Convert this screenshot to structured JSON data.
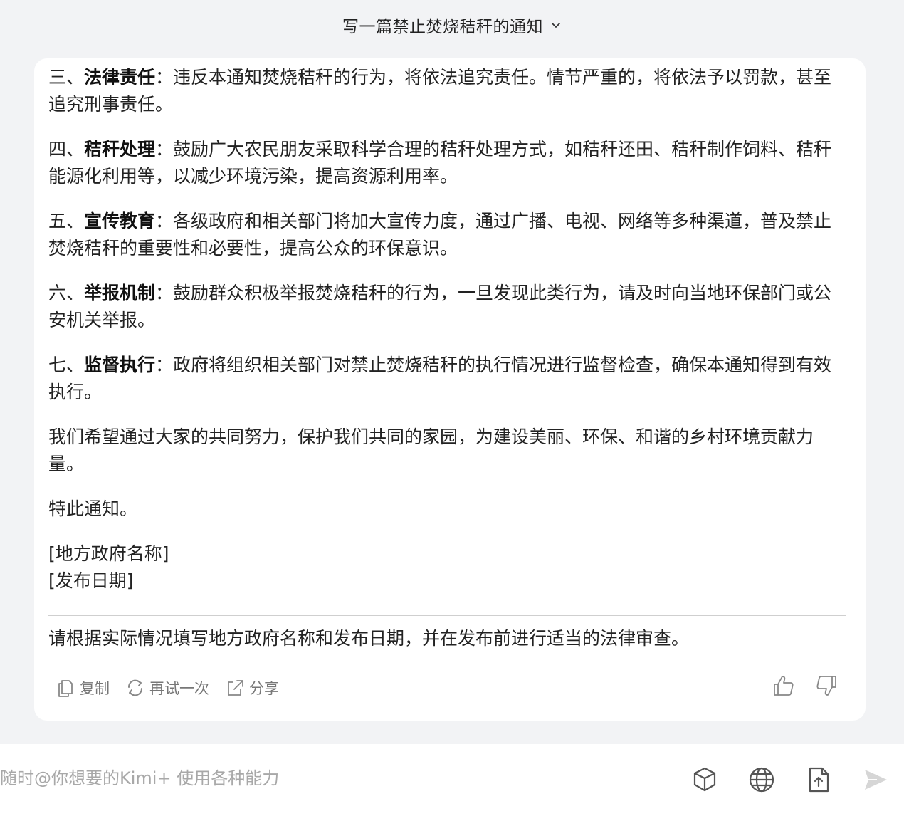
{
  "header": {
    "title": "写一篇禁止焚烧秸秆的通知"
  },
  "message": {
    "paragraphs": [
      {
        "lead": "三、",
        "bold": "法律责任",
        "text": "：违反本通知焚烧秸秆的行为，将依法追究责任。情节严重的，将依法予以罚款，甚至追究刑事责任。"
      },
      {
        "lead": "四、",
        "bold": "秸秆处理",
        "text": "：鼓励广大农民朋友采取科学合理的秸秆处理方式，如秸秆还田、秸秆制作饲料、秸秆能源化利用等，以减少环境污染，提高资源利用率。"
      },
      {
        "lead": "五、",
        "bold": "宣传教育",
        "text": "：各级政府和相关部门将加大宣传力度，通过广播、电视、网络等多种渠道，普及禁止焚烧秸秆的重要性和必要性，提高公众的环保意识。"
      },
      {
        "lead": "六、",
        "bold": "举报机制",
        "text": "：鼓励群众积极举报焚烧秸秆的行为，一旦发现此类行为，请及时向当地环保部门或公安机关举报。"
      },
      {
        "lead": "七、",
        "bold": "监督执行",
        "text": "：政府将组织相关部门对禁止焚烧秸秆的执行情况进行监督检查，确保本通知得到有效执行。"
      }
    ],
    "closing": "我们希望通过大家的共同努力，保护我们共同的家园，为建设美丽、环保、和谐的乡村环境贡献力量。",
    "notice": "特此通知。",
    "signature_name": "[地方政府名称]",
    "signature_date": "[发布日期]",
    "note": "请根据实际情况填写地方政府名称和发布日期，并在发布前进行适当的法律审查。"
  },
  "actions": {
    "copy_label": "复制",
    "retry_label": "再试一次",
    "share_label": "分享"
  },
  "input": {
    "placeholder": "随时@你想要的Kimi+ 使用各种能力"
  },
  "icons": [
    "chevron-down-icon",
    "copy-icon",
    "retry-icon",
    "share-icon",
    "thumbs-up-icon",
    "thumbs-down-icon",
    "cube-icon",
    "globe-icon",
    "file-upload-icon",
    "send-icon"
  ]
}
